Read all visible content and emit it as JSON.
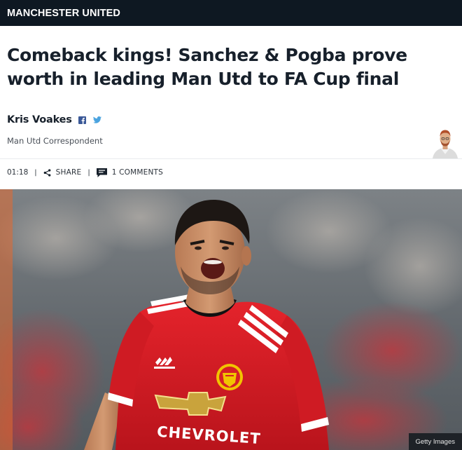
{
  "header": {
    "section": "MANCHESTER UNITED"
  },
  "article": {
    "headline": "Comeback kings! Sanchez & Pogba prove worth in leading Man Utd to FA Cup final",
    "author": {
      "name": "Kris Voakes",
      "role": "Man Utd Correspondent"
    },
    "meta": {
      "time": "01:18",
      "share_label": "SHARE",
      "comments_label": "1 COMMENTS"
    },
    "image": {
      "credit": "Getty Images"
    }
  },
  "icons": {
    "facebook": "facebook-icon",
    "twitter": "twitter-icon",
    "share": "share-icon",
    "comments": "comment-icon"
  },
  "colors": {
    "header_bg": "#0e1822",
    "facebook": "#3b5998",
    "twitter": "#4aa3df",
    "jersey_red": "#d61f26"
  }
}
